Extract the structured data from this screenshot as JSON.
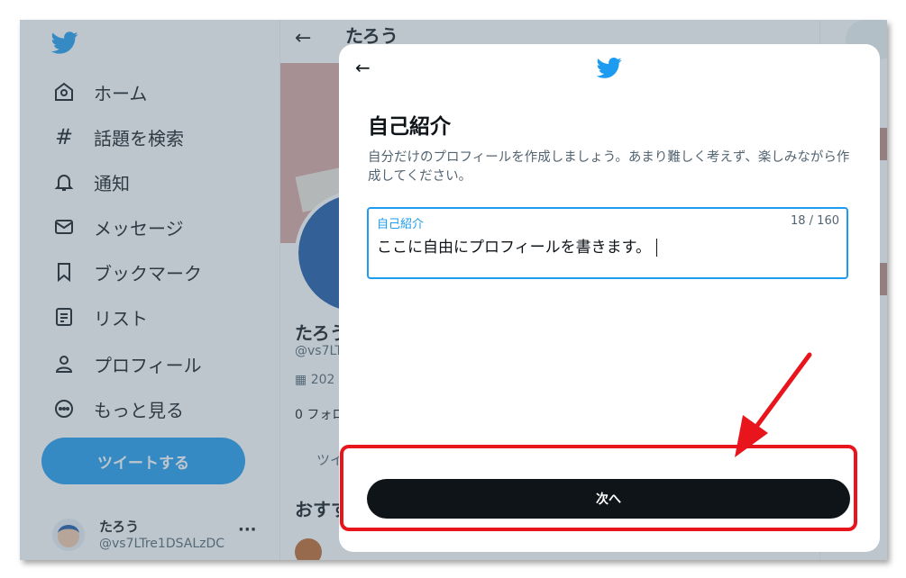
{
  "sidebar": {
    "nav": [
      {
        "label": "ホーム",
        "icon": "home-icon"
      },
      {
        "label": "話題を検索",
        "icon": "hashtag-icon"
      },
      {
        "label": "通知",
        "icon": "bell-icon"
      },
      {
        "label": "メッセージ",
        "icon": "envelope-icon"
      },
      {
        "label": "ブックマーク",
        "icon": "bookmark-icon"
      },
      {
        "label": "リスト",
        "icon": "list-icon"
      },
      {
        "label": "プロフィール",
        "icon": "person-icon"
      },
      {
        "label": "もっと見る",
        "icon": "more-circle-icon"
      }
    ],
    "tweet_button": "ツイートする",
    "account": {
      "name": "たろう",
      "handle": "@vs7LTre1DSALzDC",
      "more": "···"
    }
  },
  "main": {
    "back": "←",
    "title": "たろう",
    "profile_name": "たろう",
    "profile_handle": "@vs7LT",
    "join_date": "202",
    "follow_count": "0 フォロ",
    "tab": "ツイ",
    "suggest_title": "おすす"
  },
  "modal": {
    "back": "←",
    "title": "自己紹介",
    "description": "自分だけのプロフィールを作成しましょう。あまり難しく考えず、楽しみながら作成してください。",
    "field": {
      "label": "自己紹介",
      "counter": "18 / 160",
      "value": "ここに自由にプロフィールを書きます。"
    },
    "next_button": "次へ"
  },
  "colors": {
    "brand": "#1d9bf0",
    "highlight": "#e8161c",
    "button_dark": "#0f1419"
  }
}
